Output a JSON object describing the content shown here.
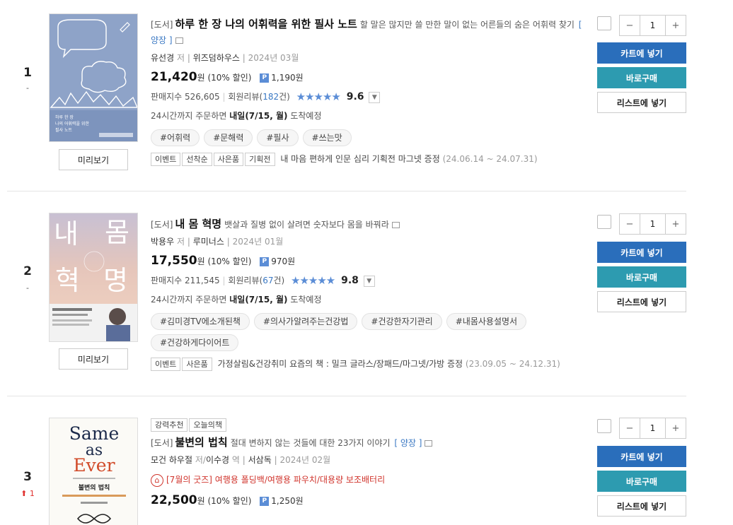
{
  "items": [
    {
      "rank": "1",
      "rank_change": "-",
      "format_tag": "[도서]",
      "title": "하루 한 장 나의 어휘력을 위한 필사 노트",
      "subtitle": "할 말은 많지만 쓸 만한 말이 없는 어른들의 숨은 어휘력 찾기",
      "edition": "[ 양장 ]",
      "author": "유선경",
      "author_role": "저",
      "publisher": "위즈덤하우스",
      "date": "2024년 03월",
      "price": "21,420",
      "price_unit": "원",
      "discount": "(10% 할인)",
      "point_badge": "P",
      "points": "1,190원",
      "sales_label": "판매지수",
      "sales": "526,605",
      "review_label": "회원리뷰",
      "review_count": "182",
      "review_unit": "건",
      "stars": "★★★★★",
      "score": "9.6",
      "delivery_prefix": "24시간까지 주문하면",
      "delivery_date": "내일(7/15, 월)",
      "delivery_suffix": "도착예정",
      "hashtags": [
        "#어휘력",
        "#문해력",
        "#필사",
        "#쓰는맛"
      ],
      "event_tags": [
        "이벤트",
        "선착순",
        "사은품",
        "기획전"
      ],
      "event_text": "내 마음 편하게 인문 심리 기획전 마그넷 증정",
      "event_date": "(24.06.14 ~ 24.07.31)",
      "cover_title": "하루 한 장\n나의 어휘력을 위한\n필사 노트"
    },
    {
      "rank": "2",
      "rank_change": "-",
      "format_tag": "[도서]",
      "title": "내 몸 혁명",
      "subtitle": "뱃살과 질병 없이 살려면 숫자보다 몸을 바꿔라",
      "author": "박용우",
      "author_role": "저",
      "publisher": "루미너스",
      "date": "2024년 01월",
      "price": "17,550",
      "price_unit": "원",
      "discount": "(10% 할인)",
      "point_badge": "P",
      "points": "970원",
      "sales_label": "판매지수",
      "sales": "211,545",
      "review_label": "회원리뷰",
      "review_count": "67",
      "review_unit": "건",
      "stars": "★★★★★",
      "score": "9.8",
      "delivery_prefix": "24시간까지 주문하면",
      "delivery_date": "내일(7/15, 월)",
      "delivery_suffix": "도착예정",
      "hashtags": [
        "#김미경TV에소개된책",
        "#의사가알려주는건강법",
        "#건강한자기관리",
        "#내몸사용설명서",
        "#건강하게다이어트"
      ],
      "event_tags": [
        "이벤트",
        "사은품"
      ],
      "event_text": "가정살림&건강취미 요즘의 책 : 밀크 글라스/장패드/마그넷/가방 증정",
      "event_date": "(23.09.05 ~ 24.12.31)",
      "cover_big": [
        "내",
        "몸",
        "혁",
        "명"
      ]
    },
    {
      "rank": "3",
      "rank_change": "1",
      "badges": [
        "강력추천",
        "오늘의책"
      ],
      "format_tag": "[도서]",
      "title": "불변의 법칙",
      "subtitle": "절대 변하지 않는 것들에 대한 23가지 이야기",
      "edition": "[ 양장 ]",
      "author": "모건 하우절",
      "author_role": "저",
      "translator": "이수경",
      "translator_role": "역",
      "publisher": "서삼독",
      "date": "2024년 02월",
      "gift_text": "[7월의 굿즈] 여행용 폴딩백/여행용 파우치/대용량 보조배터리",
      "price": "22,500",
      "price_unit": "원",
      "discount": "(10% 할인)",
      "point_badge": "P",
      "points": "1,250원",
      "cover_en": [
        "Same",
        "as",
        "Ever"
      ],
      "cover_kr": "불변의 법칙"
    }
  ],
  "ui": {
    "preview_label": "미리보기",
    "cart_label": "카트에 넣기",
    "buy_label": "바로구매",
    "list_label": "리스트에 넣기",
    "qty": "1",
    "minus": "−",
    "plus": "+"
  },
  "colors": {
    "cart": "#2a6ebb",
    "buy": "#2d9bb0",
    "star": "#5b8dd6",
    "gift": "#d0342c"
  }
}
